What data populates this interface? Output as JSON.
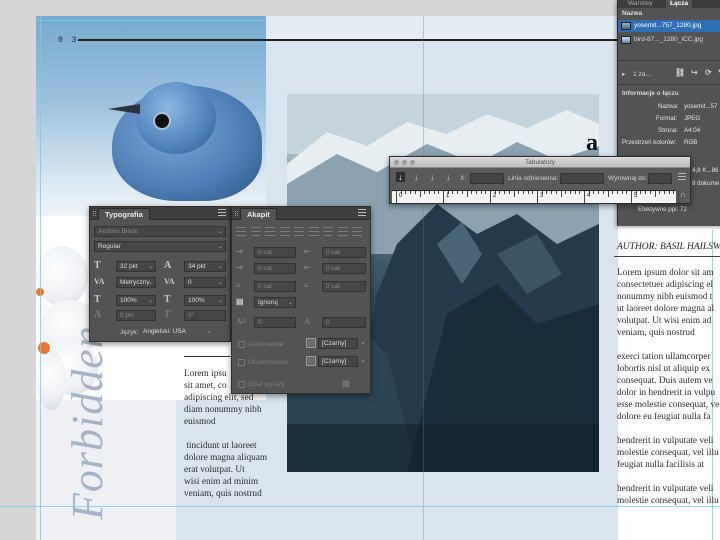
{
  "document": {
    "page_number": "0 3",
    "author": "AUTHOR: BASIL HAILSWA",
    "vertical_title": "Forbidden",
    "drop_letter": "a",
    "left_column": [
      "Lorem ipsu",
      "sit amet, co",
      "adipiscing elit, sed",
      "diam nonummy nibh",
      "euismod",
      "",
      " tincidunt ut laoreet",
      "dolore magna aliquam",
      "erat volutpat. Ut",
      "wisi enim ad minim",
      "veniam, quis nostrud"
    ],
    "right_column": [
      "Lorem ipsum dolor sit am",
      "consectetuer adipiscing el",
      "nonummy nibh euismod t",
      "ut laoreet dolore magna al",
      "volutpat. Ut wisi enim ad",
      "veniam, quis nostrud",
      "",
      "exerci tation ullamcorper",
      "lobortis nisl ut aliquip ex",
      "consequat. Duis autem ve",
      "dolor in hendrerit in vulpu",
      "esse molestie consequat, ve",
      "dolore eu feugiat nulla fa",
      "",
      "hendrerit in vulputate veli",
      "molestie consequat, vel illu",
      "feugiat nulla facilisis at",
      "",
      "hendrerit in vulputate veli",
      "molestie consequat, vel illu"
    ]
  },
  "links_panel": {
    "tabs": [
      "Warstwy",
      "Łącza"
    ],
    "header": "Nazwa",
    "files": [
      "yosemit...757_1280.jpg",
      "bird-87..._1280_ICC.jpg"
    ],
    "count_label": "1 za...",
    "info_header": "Informacje o łączu",
    "info": [
      {
        "k": "Nazwa:",
        "v": "yosemit...57"
      },
      {
        "k": "Format:",
        "v": "JPEG"
      },
      {
        "k": "Strona:",
        "v": "A4:04"
      },
      {
        "k": "Przestrzeń kolorów:",
        "v": "RGB"
      },
      {
        "k": "",
        "v": "8 dokume"
      }
    ],
    "size_info": "4,8 K...86",
    "ppi": "Efektywne ppi: 72"
  },
  "typography_panel": {
    "title": "Typografia",
    "font_family": "Archivo Black",
    "font_style": "Regular",
    "size": "32 pkt",
    "leading": "34 pkt",
    "kerning": "Metryczny",
    "tracking": "0",
    "vscale": "100%",
    "hscale": "100%",
    "baseline": "0 pkt",
    "skew": "0°",
    "language_label": "Język:",
    "language": "Angielski: USA"
  },
  "paragraph_panel": {
    "title": "Akapit",
    "left_indent": "0 cal",
    "right_indent": "0 cal",
    "first_indent": "0 cal",
    "last_indent": "0 cal",
    "space_before": "0 cal",
    "space_after": "0 cal",
    "align_grid": "Ignoruj",
    "drop_lines": "0",
    "drop_chars": "0",
    "shading_label": "Cieniowanie",
    "border_label": "Obramowanie",
    "swatch": "[Czarny]",
    "hyphenate_label": "Dziel wyrazy"
  },
  "tabulators_panel": {
    "title": "Tabulatory",
    "x_label": "X:",
    "leader_label": "Linia odniesienia:",
    "align_label": "Wyrównaj do:",
    "ruler_numbers": [
      "0",
      "1",
      "2",
      "3",
      "4",
      "5"
    ]
  },
  "colors": {
    "panel_bg": "#535353",
    "panel_dark": "#3f3f3f",
    "selection_blue": "#2f6fb8",
    "guide": "#6fd0e6"
  }
}
